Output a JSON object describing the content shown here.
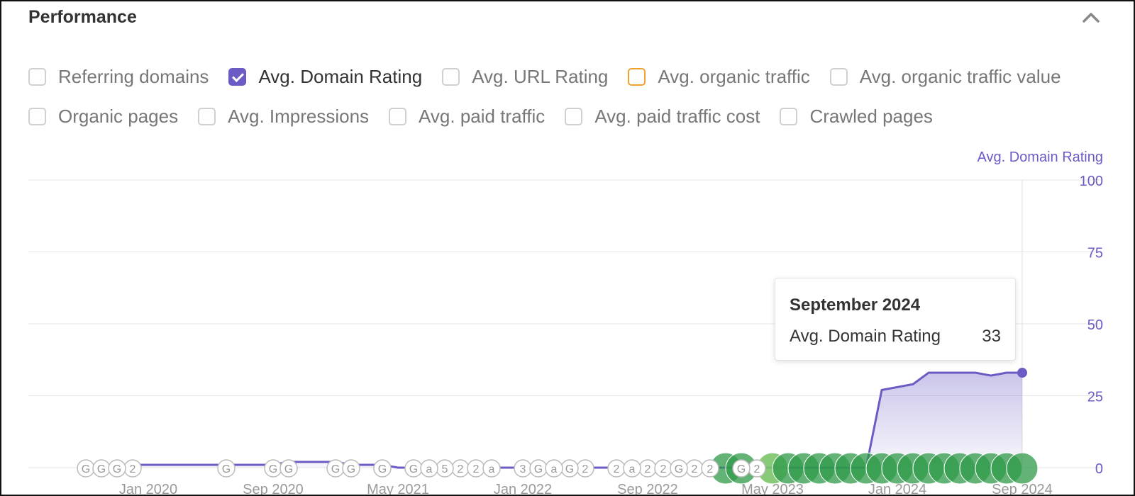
{
  "panel": {
    "title": "Performance",
    "collapse_icon": "chevron-up-icon"
  },
  "filters": [
    {
      "id": "referring-domains",
      "label": "Referring domains",
      "checked": false,
      "color": "#d0d0d0"
    },
    {
      "id": "avg-domain-rating",
      "label": "Avg. Domain Rating",
      "checked": true,
      "color": "#6a5cc4"
    },
    {
      "id": "avg-url-rating",
      "label": "Avg. URL Rating",
      "checked": false,
      "color": "#d0d0d0"
    },
    {
      "id": "avg-organic-traffic",
      "label": "Avg. organic traffic",
      "checked": false,
      "color": "#f0a12f"
    },
    {
      "id": "avg-organic-traffic-value",
      "label": "Avg. organic traffic value",
      "checked": false,
      "color": "#d0d0d0"
    },
    {
      "id": "organic-pages",
      "label": "Organic pages",
      "checked": false,
      "color": "#d0d0d0"
    },
    {
      "id": "avg-impressions",
      "label": "Avg. Impressions",
      "checked": false,
      "color": "#d0d0d0"
    },
    {
      "id": "avg-paid-traffic",
      "label": "Avg. paid traffic",
      "checked": false,
      "color": "#d0d0d0"
    },
    {
      "id": "avg-paid-traffic-cost",
      "label": "Avg. paid traffic cost",
      "checked": false,
      "color": "#d0d0d0"
    },
    {
      "id": "crawled-pages",
      "label": "Crawled pages",
      "checked": false,
      "color": "#d0d0d0"
    }
  ],
  "chart_data": {
    "type": "area",
    "series": [
      {
        "name": "Avg. Domain Rating",
        "color": "#6a5cc4",
        "x": [
          "2019-09",
          "2019-10",
          "2019-11",
          "2019-12",
          "2020-01",
          "2020-02",
          "2020-03",
          "2020-04",
          "2020-05",
          "2020-06",
          "2020-07",
          "2020-08",
          "2020-09",
          "2020-10",
          "2020-11",
          "2020-12",
          "2021-01",
          "2021-02",
          "2021-03",
          "2021-04",
          "2021-05",
          "2021-06",
          "2021-07",
          "2021-08",
          "2021-09",
          "2021-10",
          "2021-11",
          "2021-12",
          "2022-01",
          "2022-02",
          "2022-03",
          "2022-04",
          "2022-05",
          "2022-06",
          "2022-07",
          "2022-08",
          "2022-09",
          "2022-10",
          "2022-11",
          "2022-12",
          "2023-01",
          "2023-02",
          "2023-03",
          "2023-04",
          "2023-05",
          "2023-06",
          "2023-07",
          "2023-08",
          "2023-09",
          "2023-10",
          "2023-11",
          "2023-12",
          "2024-01",
          "2024-02",
          "2024-03",
          "2024-04",
          "2024-05",
          "2024-06",
          "2024-07",
          "2024-08",
          "2024-09"
        ],
        "values": [
          0,
          1,
          1,
          1,
          1,
          1,
          1,
          1,
          1,
          1,
          1,
          1,
          1,
          2,
          2,
          2,
          2,
          1,
          1,
          1,
          0,
          0,
          0,
          0,
          0,
          0,
          0,
          0,
          0,
          0,
          0,
          0,
          0,
          0,
          0,
          0,
          0,
          0,
          0,
          0,
          0,
          0,
          0,
          0,
          0,
          0,
          0,
          0,
          0,
          0,
          0,
          27,
          28,
          29,
          33,
          33,
          33,
          33,
          32,
          33,
          33
        ]
      }
    ],
    "annotations": {
      "markers": {
        "G": [
          "2019-09",
          "2019-10",
          "2019-11",
          "2020-06",
          "2020-09",
          "2020-10",
          "2021-01",
          "2021-02",
          "2021-04",
          "2021-06",
          "2022-02",
          "2022-04",
          "2022-11",
          "2023-03"
        ],
        "2": [
          "2019-12",
          "2021-09",
          "2021-10",
          "2022-05",
          "2022-07",
          "2022-09",
          "2022-10",
          "2022-12",
          "2023-01",
          "2023-04"
        ],
        "a": [
          "2021-07",
          "2021-11",
          "2022-03",
          "2022-08"
        ],
        "5": [
          "2021-08"
        ],
        "3": [
          "2022-01"
        ]
      },
      "rich_markers": [
        "2023-02",
        "2023-03",
        "2023-05",
        "2023-06",
        "2023-07",
        "2023-08",
        "2023-09",
        "2023-10",
        "2023-11",
        "2023-12",
        "2024-01",
        "2024-02",
        "2024-03",
        "2024-04",
        "2024-05",
        "2024-06",
        "2024-07",
        "2024-08",
        "2024-09"
      ]
    },
    "x_ticks": [
      {
        "label": "Jan 2020",
        "value": "2020-01"
      },
      {
        "label": "Sep 2020",
        "value": "2020-09"
      },
      {
        "label": "May 2021",
        "value": "2021-05"
      },
      {
        "label": "Jan 2022",
        "value": "2022-01"
      },
      {
        "label": "Sep 2022",
        "value": "2022-09"
      },
      {
        "label": "May 2023",
        "value": "2023-05"
      },
      {
        "label": "Jan 2024",
        "value": "2024-01"
      },
      {
        "label": "Sep 2024",
        "value": "2024-09"
      }
    ],
    "y_axis": {
      "title": "Avg. Domain Rating",
      "ticks": [
        "100",
        "75",
        "50",
        "25",
        "0"
      ],
      "range": [
        0,
        100
      ],
      "position": "right"
    },
    "grid": true
  },
  "tooltip": {
    "title": "September 2024",
    "label": "Avg. Domain Rating",
    "value": "33"
  }
}
